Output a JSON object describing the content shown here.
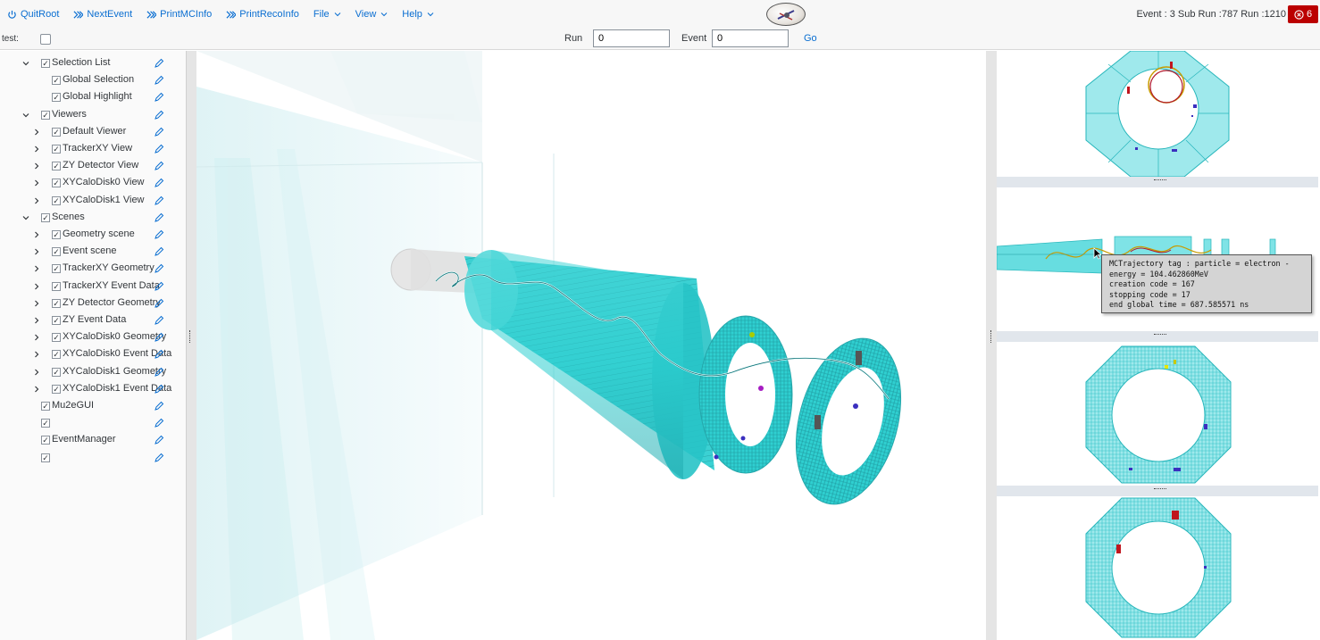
{
  "toolbar": {
    "quit_label": "QuitRoot",
    "next_label": "NextEvent",
    "print_mc_label": "PrintMCInfo",
    "print_reco_label": "PrintRecoInfo",
    "menus": [
      "File",
      "View",
      "Help"
    ],
    "event_status": "Event : 3 Sub Run :787 Run :1210",
    "error_count": "6",
    "accent_color": "#0a6ed1",
    "error_color": "#bb0000"
  },
  "bar2": {
    "test_label": "test:",
    "run_label": "Run",
    "run_value": "0",
    "event_label": "Event",
    "event_value": "0",
    "go_label": "Go"
  },
  "tree": [
    {
      "label": "Selection List",
      "checked": true,
      "level": 1,
      "expand": "open"
    },
    {
      "label": "Global Selection",
      "checked": true,
      "level": 2,
      "expand": "none"
    },
    {
      "label": "Global Highlight",
      "checked": true,
      "level": 2,
      "expand": "none"
    },
    {
      "label": "Viewers",
      "checked": true,
      "level": 1,
      "expand": "open"
    },
    {
      "label": "Default Viewer",
      "checked": true,
      "level": 2,
      "expand": "closed"
    },
    {
      "label": "TrackerXY View",
      "checked": true,
      "level": 2,
      "expand": "closed"
    },
    {
      "label": "ZY Detector View",
      "checked": true,
      "level": 2,
      "expand": "closed"
    },
    {
      "label": "XYCaloDisk0 View",
      "checked": true,
      "level": 2,
      "expand": "closed"
    },
    {
      "label": "XYCaloDisk1 View",
      "checked": true,
      "level": 2,
      "expand": "closed"
    },
    {
      "label": "Scenes",
      "checked": true,
      "level": 1,
      "expand": "open"
    },
    {
      "label": "Geometry scene",
      "checked": true,
      "level": 2,
      "expand": "closed"
    },
    {
      "label": "Event scene",
      "checked": true,
      "level": 2,
      "expand": "closed"
    },
    {
      "label": "TrackerXY Geometry",
      "checked": true,
      "level": 2,
      "expand": "closed"
    },
    {
      "label": "TrackerXY Event Data",
      "checked": true,
      "level": 2,
      "expand": "closed"
    },
    {
      "label": "ZY Detector Geometry",
      "checked": true,
      "level": 2,
      "expand": "closed"
    },
    {
      "label": "ZY Event Data",
      "checked": true,
      "level": 2,
      "expand": "closed"
    },
    {
      "label": "XYCaloDisk0 Geometry",
      "checked": true,
      "level": 2,
      "expand": "closed"
    },
    {
      "label": "XYCaloDisk0 Event Data",
      "checked": true,
      "level": 2,
      "expand": "closed"
    },
    {
      "label": "XYCaloDisk1 Geometry",
      "checked": true,
      "level": 2,
      "expand": "closed"
    },
    {
      "label": "XYCaloDisk1 Event Data",
      "checked": true,
      "level": 2,
      "expand": "closed"
    },
    {
      "label": "Mu2eGUI",
      "checked": true,
      "level": 1,
      "expand": "none"
    },
    {
      "label": "",
      "checked": true,
      "level": 1,
      "expand": "none"
    },
    {
      "label": "EventManager",
      "checked": true,
      "level": 1,
      "expand": "none"
    },
    {
      "label": "",
      "checked": true,
      "level": 1,
      "expand": "none"
    }
  ],
  "tooltip": {
    "lines": [
      "MCTrajectory tag : particle = electron -",
      "energy = 104.462860MeV",
      "creation code = 167",
      "stopping code = 17",
      "end global time = 687.585571 ns"
    ]
  },
  "icons": {
    "quit": "power-icon",
    "next": "double-chevron-right-icon",
    "edit": "pencil-icon",
    "error": "error-circle-icon"
  },
  "colors": {
    "detector": "#2ccfd0",
    "track": "#c89b00",
    "hit_red": "#c0161e",
    "hit_blue": "#3b2fbf"
  }
}
